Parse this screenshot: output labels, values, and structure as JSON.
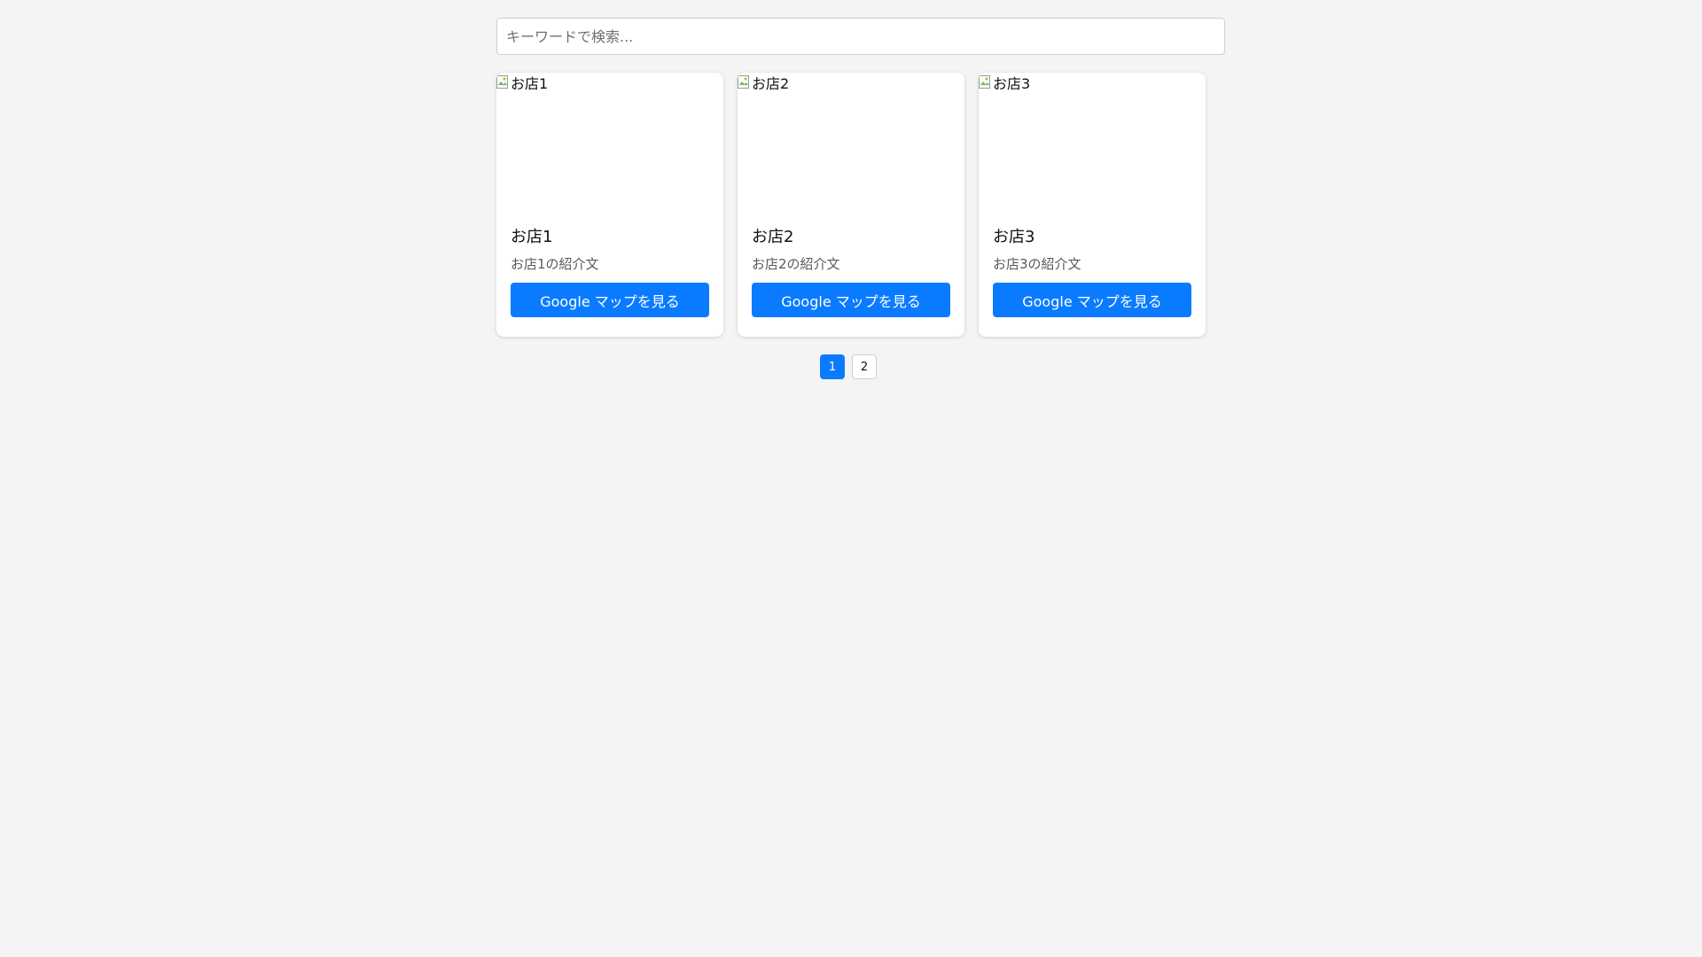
{
  "search": {
    "placeholder": "キーワードで検索...",
    "value": ""
  },
  "stores": [
    {
      "image_alt": "お店1",
      "name": "お店1",
      "description": "お店1の紹介文",
      "button_label": "Google マップを見る"
    },
    {
      "image_alt": "お店2",
      "name": "お店2",
      "description": "お店2の紹介文",
      "button_label": "Google マップを見る"
    },
    {
      "image_alt": "お店3",
      "name": "お店3",
      "description": "お店3の紹介文",
      "button_label": "Google マップを見る"
    }
  ],
  "pagination": {
    "pages": [
      "1",
      "2"
    ],
    "current": "1"
  },
  "colors": {
    "accent": "#0a7bff",
    "background": "#f4f4f4",
    "card": "#ffffff"
  },
  "icons": {
    "image_placeholder": "broken-image-icon"
  }
}
